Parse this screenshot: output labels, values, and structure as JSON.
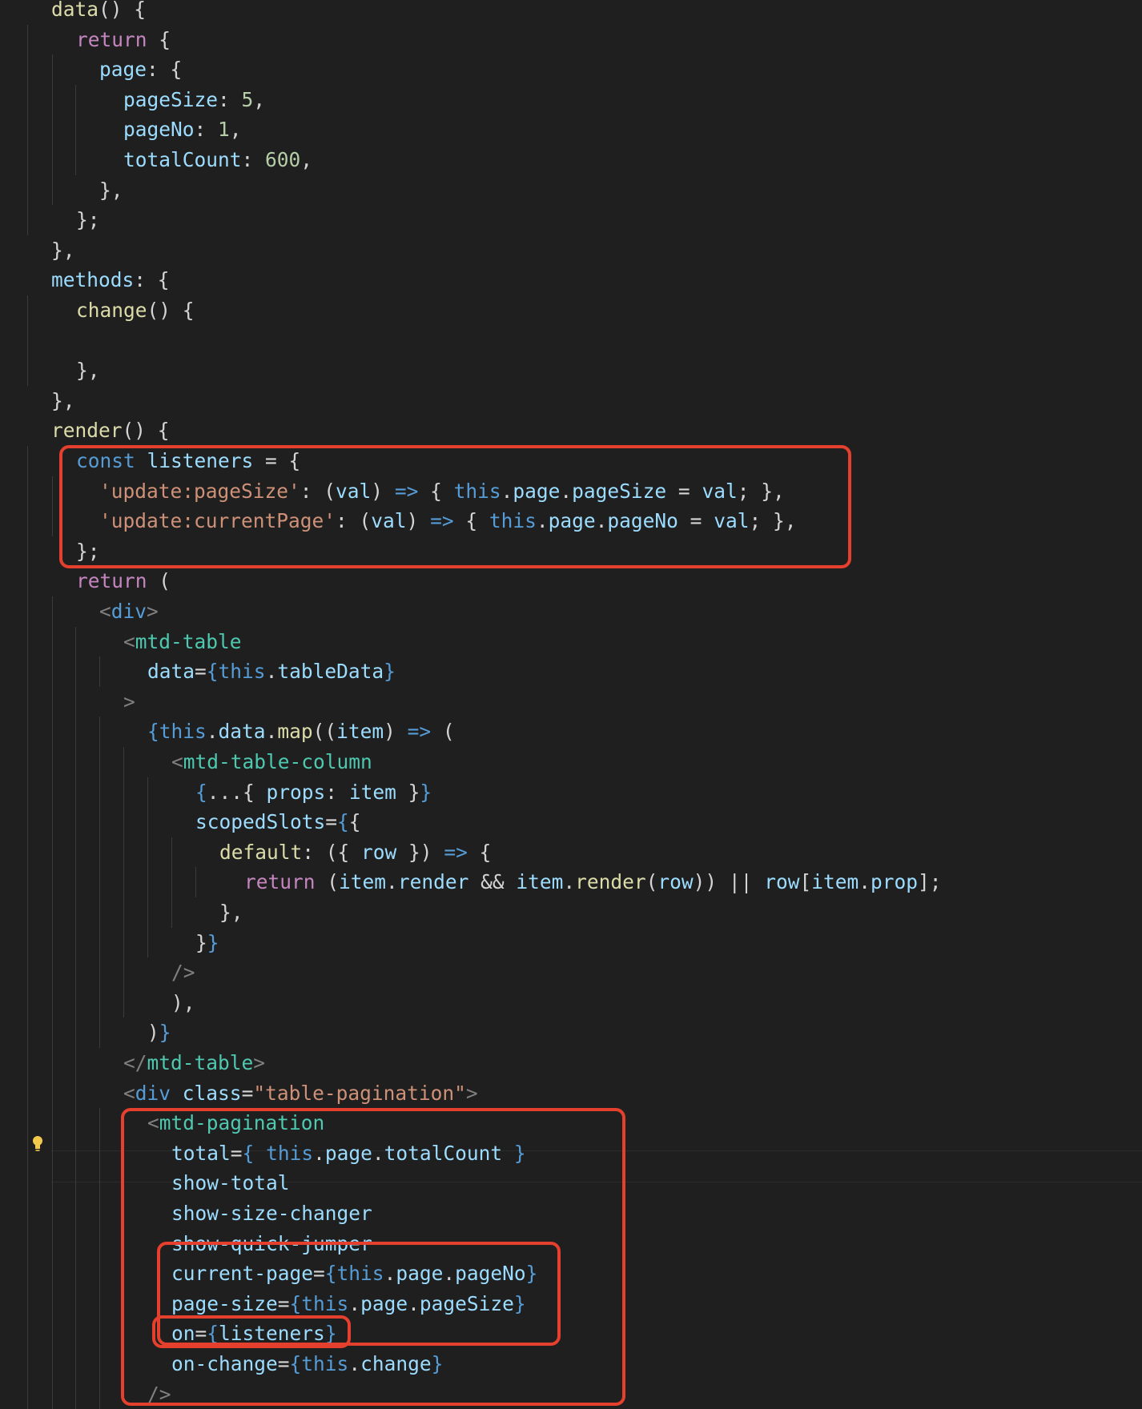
{
  "editor": {
    "lines": [
      [
        [
          "tk-fn",
          "data"
        ],
        [
          "tk-p",
          "() {"
        ]
      ],
      [
        [
          "tk-kw",
          "return"
        ],
        [
          "tk-p",
          " {"
        ]
      ],
      [
        [
          "tk-prop",
          "page"
        ],
        [
          "tk-p",
          ": {"
        ]
      ],
      [
        [
          "tk-prop",
          "pageSize"
        ],
        [
          "tk-p",
          ": "
        ],
        [
          "tk-num",
          "5"
        ],
        [
          "tk-p",
          ","
        ]
      ],
      [
        [
          "tk-prop",
          "pageNo"
        ],
        [
          "tk-p",
          ": "
        ],
        [
          "tk-num",
          "1"
        ],
        [
          "tk-p",
          ","
        ]
      ],
      [
        [
          "tk-prop",
          "totalCount"
        ],
        [
          "tk-p",
          ": "
        ],
        [
          "tk-num",
          "600"
        ],
        [
          "tk-p",
          ","
        ]
      ],
      [
        [
          "tk-p",
          "},"
        ]
      ],
      [
        [
          "tk-p",
          "};"
        ]
      ],
      [
        [
          "tk-p",
          "},"
        ]
      ],
      [
        [
          "tk-prop",
          "methods"
        ],
        [
          "tk-p",
          ": {"
        ]
      ],
      [
        [
          "tk-fn",
          "change"
        ],
        [
          "tk-p",
          "() {"
        ]
      ],
      [],
      [
        [
          "tk-p",
          "},"
        ]
      ],
      [
        [
          "tk-p",
          "},"
        ]
      ],
      [
        [
          "tk-fn",
          "render"
        ],
        [
          "tk-p",
          "() {"
        ]
      ],
      [
        [
          "tk-dec",
          "const"
        ],
        [
          "tk-p",
          " "
        ],
        [
          "tk-var",
          "listeners"
        ],
        [
          "tk-p",
          " = {"
        ]
      ],
      [
        [
          "tk-str",
          "'update:pageSize'"
        ],
        [
          "tk-p",
          ": ("
        ],
        [
          "tk-var",
          "val"
        ],
        [
          "tk-p",
          ") "
        ],
        [
          "tk-dec",
          "=>"
        ],
        [
          "tk-p",
          " { "
        ],
        [
          "tk-dec",
          "this"
        ],
        [
          "tk-p",
          "."
        ],
        [
          "tk-var",
          "page"
        ],
        [
          "tk-p",
          "."
        ],
        [
          "tk-var",
          "pageSize"
        ],
        [
          "tk-p",
          " = "
        ],
        [
          "tk-var",
          "val"
        ],
        [
          "tk-p",
          "; },"
        ]
      ],
      [
        [
          "tk-str",
          "'update:currentPage'"
        ],
        [
          "tk-p",
          ": ("
        ],
        [
          "tk-var",
          "val"
        ],
        [
          "tk-p",
          ") "
        ],
        [
          "tk-dec",
          "=>"
        ],
        [
          "tk-p",
          " { "
        ],
        [
          "tk-dec",
          "this"
        ],
        [
          "tk-p",
          "."
        ],
        [
          "tk-var",
          "page"
        ],
        [
          "tk-p",
          "."
        ],
        [
          "tk-var",
          "pageNo"
        ],
        [
          "tk-p",
          " = "
        ],
        [
          "tk-var",
          "val"
        ],
        [
          "tk-p",
          "; },"
        ]
      ],
      [
        [
          "tk-p",
          "};"
        ]
      ],
      [
        [
          "tk-kw",
          "return"
        ],
        [
          "tk-p",
          " ("
        ]
      ],
      [
        [
          "tk-br",
          "<"
        ],
        [
          "tk-dec",
          "div"
        ],
        [
          "tk-br",
          ">"
        ]
      ],
      [
        [
          "tk-br",
          "<"
        ],
        [
          "tk-tag",
          "mtd-table"
        ]
      ],
      [
        [
          "tk-attr",
          "data"
        ],
        [
          "tk-p",
          "="
        ],
        [
          "tk-dec",
          "{"
        ],
        [
          "tk-dec",
          "this"
        ],
        [
          "tk-p",
          "."
        ],
        [
          "tk-var",
          "tableData"
        ],
        [
          "tk-dec",
          "}"
        ]
      ],
      [
        [
          "tk-br",
          ">"
        ]
      ],
      [
        [
          "tk-dec",
          "{"
        ],
        [
          "tk-dec",
          "this"
        ],
        [
          "tk-p",
          "."
        ],
        [
          "tk-var",
          "data"
        ],
        [
          "tk-p",
          "."
        ],
        [
          "tk-fn",
          "map"
        ],
        [
          "tk-p",
          "(("
        ],
        [
          "tk-var",
          "item"
        ],
        [
          "tk-p",
          ") "
        ],
        [
          "tk-dec",
          "=>"
        ],
        [
          "tk-p",
          " ("
        ]
      ],
      [
        [
          "tk-br",
          "<"
        ],
        [
          "tk-tag",
          "mtd-table-column"
        ]
      ],
      [
        [
          "tk-dec",
          "{"
        ],
        [
          "tk-p",
          "...{ "
        ],
        [
          "tk-prop",
          "props"
        ],
        [
          "tk-p",
          ": "
        ],
        [
          "tk-var",
          "item"
        ],
        [
          "tk-p",
          " }"
        ],
        [
          "tk-dec",
          "}"
        ]
      ],
      [
        [
          "tk-attr",
          "scopedSlots"
        ],
        [
          "tk-p",
          "="
        ],
        [
          "tk-dec",
          "{"
        ],
        [
          "tk-p",
          "{"
        ]
      ],
      [
        [
          "tk-fn",
          "default"
        ],
        [
          "tk-p",
          ": ({ "
        ],
        [
          "tk-var",
          "row"
        ],
        [
          "tk-p",
          " }) "
        ],
        [
          "tk-dec",
          "=>"
        ],
        [
          "tk-p",
          " {"
        ]
      ],
      [
        [
          "tk-kw",
          "return"
        ],
        [
          "tk-p",
          " ("
        ],
        [
          "tk-var",
          "item"
        ],
        [
          "tk-p",
          "."
        ],
        [
          "tk-var",
          "render"
        ],
        [
          "tk-p",
          " && "
        ],
        [
          "tk-var",
          "item"
        ],
        [
          "tk-p",
          "."
        ],
        [
          "tk-fn",
          "render"
        ],
        [
          "tk-p",
          "("
        ],
        [
          "tk-var",
          "row"
        ],
        [
          "tk-p",
          ")) || "
        ],
        [
          "tk-var",
          "row"
        ],
        [
          "tk-p",
          "["
        ],
        [
          "tk-var",
          "item"
        ],
        [
          "tk-p",
          "."
        ],
        [
          "tk-var",
          "prop"
        ],
        [
          "tk-p",
          "];"
        ]
      ],
      [
        [
          "tk-p",
          "},"
        ]
      ],
      [
        [
          "tk-p",
          "}"
        ],
        [
          "tk-dec",
          "}"
        ]
      ],
      [
        [
          "tk-br",
          "/>"
        ]
      ],
      [
        [
          "tk-p",
          "),"
        ]
      ],
      [
        [
          "tk-p",
          ")"
        ],
        [
          "tk-dec",
          "}"
        ]
      ],
      [
        [
          "tk-br",
          "</"
        ],
        [
          "tk-tag",
          "mtd-table"
        ],
        [
          "tk-br",
          ">"
        ]
      ],
      [
        [
          "tk-br",
          "<"
        ],
        [
          "tk-dec",
          "div"
        ],
        [
          "tk-p",
          " "
        ],
        [
          "tk-attr",
          "class"
        ],
        [
          "tk-p",
          "="
        ],
        [
          "tk-str",
          "\"table-pagination\""
        ],
        [
          "tk-br",
          ">"
        ]
      ],
      [
        [
          "tk-br",
          "<"
        ],
        [
          "tk-tag",
          "mtd-pagination"
        ]
      ],
      [
        [
          "tk-attr",
          "total"
        ],
        [
          "tk-p",
          "="
        ],
        [
          "tk-dec",
          "{"
        ],
        [
          "tk-p",
          " "
        ],
        [
          "tk-dec",
          "this"
        ],
        [
          "tk-p",
          "."
        ],
        [
          "tk-var",
          "page"
        ],
        [
          "tk-p",
          "."
        ],
        [
          "tk-var",
          "totalCount"
        ],
        [
          "tk-p",
          " "
        ],
        [
          "tk-dec",
          "}"
        ]
      ],
      [
        [
          "tk-attr",
          "show-total"
        ]
      ],
      [
        [
          "tk-attr",
          "show-size-changer"
        ]
      ],
      [
        [
          "tk-attr",
          "show-quick-jumper"
        ]
      ],
      [
        [
          "tk-attr",
          "current-page"
        ],
        [
          "tk-p",
          "="
        ],
        [
          "tk-dec",
          "{"
        ],
        [
          "tk-dec",
          "this"
        ],
        [
          "tk-p",
          "."
        ],
        [
          "tk-var",
          "page"
        ],
        [
          "tk-p",
          "."
        ],
        [
          "tk-var",
          "pageNo"
        ],
        [
          "tk-dec",
          "}"
        ]
      ],
      [
        [
          "tk-attr",
          "page-size"
        ],
        [
          "tk-p",
          "="
        ],
        [
          "tk-dec",
          "{"
        ],
        [
          "tk-dec",
          "this"
        ],
        [
          "tk-p",
          "."
        ],
        [
          "tk-var",
          "page"
        ],
        [
          "tk-p",
          "."
        ],
        [
          "tk-var",
          "pageSize"
        ],
        [
          "tk-dec",
          "}"
        ]
      ],
      [
        [
          "tk-attr",
          "on"
        ],
        [
          "tk-p",
          "="
        ],
        [
          "tk-dec",
          "{"
        ],
        [
          "tk-var",
          "listeners"
        ],
        [
          "tk-dec",
          "}"
        ]
      ],
      [
        [
          "tk-attr",
          "on-change"
        ],
        [
          "tk-p",
          "="
        ],
        [
          "tk-dec",
          "{"
        ],
        [
          "tk-dec",
          "this"
        ],
        [
          "tk-p",
          "."
        ],
        [
          "tk-var",
          "change"
        ],
        [
          "tk-dec",
          "}"
        ]
      ],
      [
        [
          "tk-br",
          "/>"
        ]
      ]
    ]
  },
  "colors": {
    "background": "#1f1f1f",
    "highlight_box": "#e5402d",
    "lightbulb": "#f2c94c"
  },
  "icons": {
    "lightbulb": "lightbulb-icon"
  }
}
